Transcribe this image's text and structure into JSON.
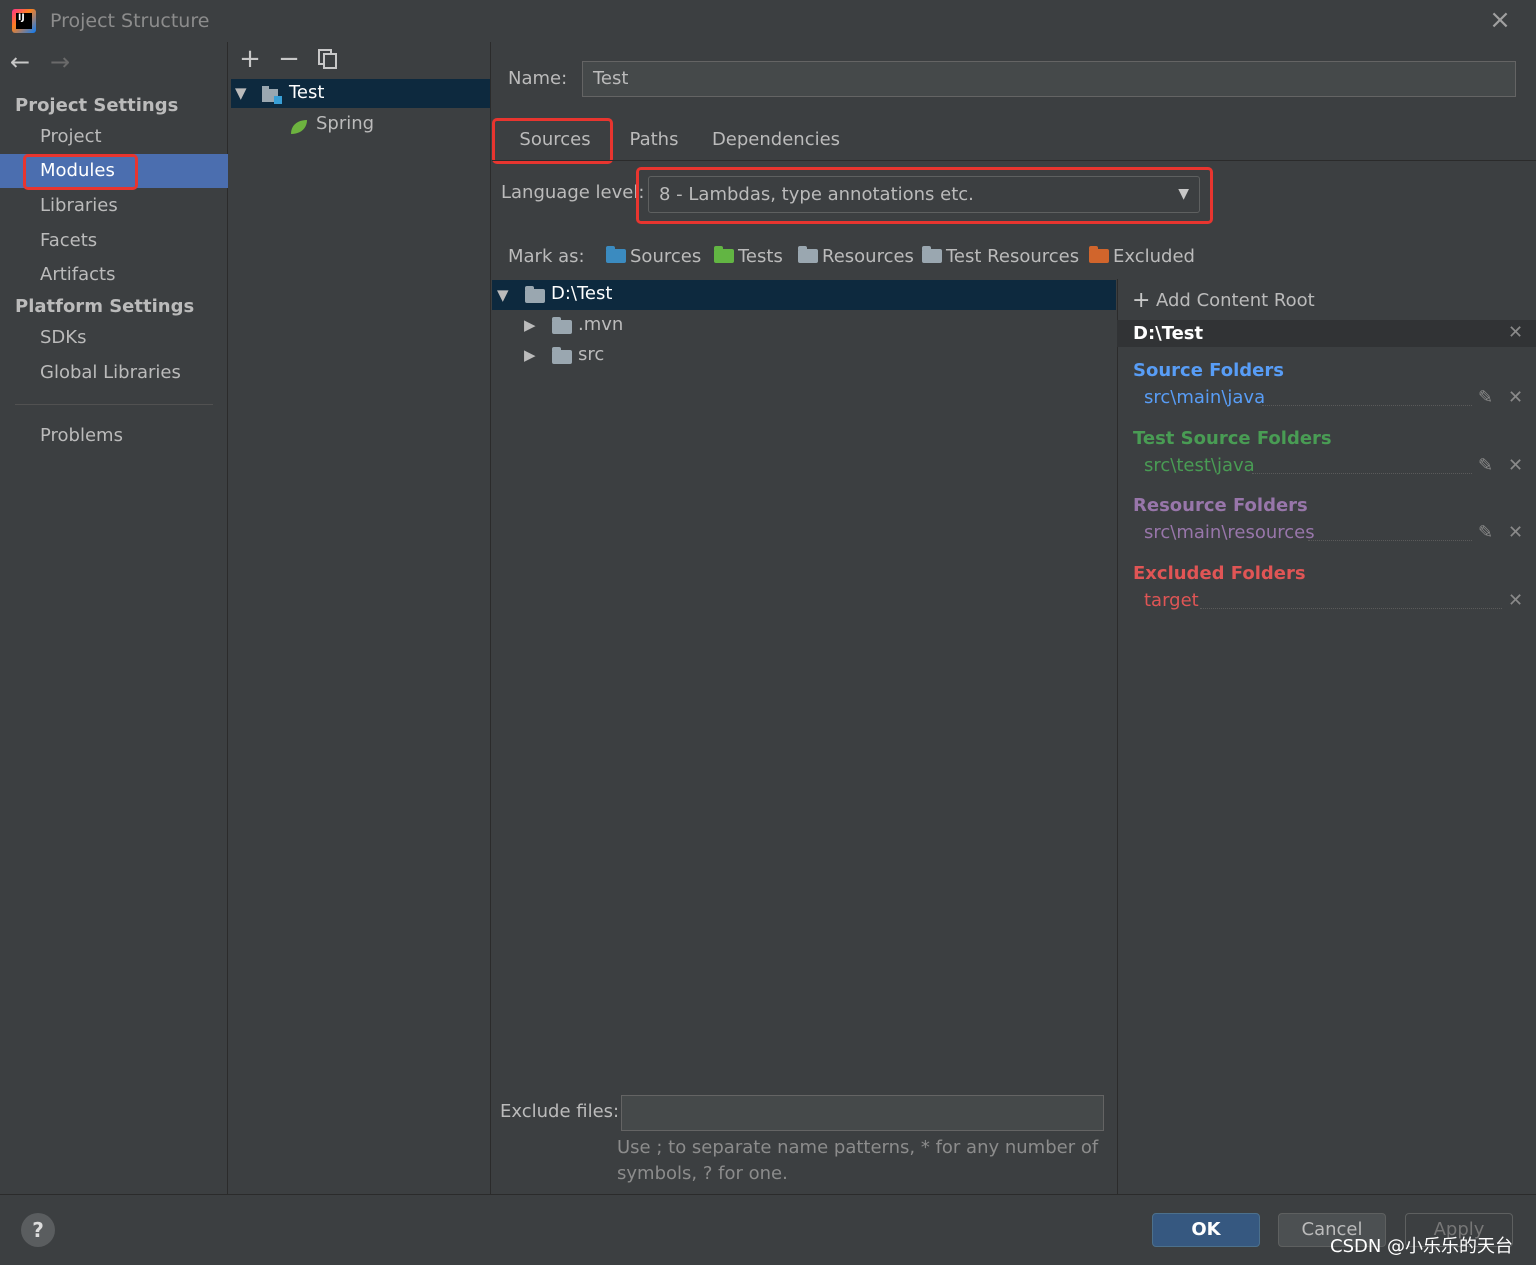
{
  "window": {
    "title": "Project Structure",
    "app_icon_text": "IJ"
  },
  "sidebar": {
    "project_settings_header": "Project Settings",
    "project_items": [
      "Project",
      "Modules",
      "Libraries",
      "Facets",
      "Artifacts"
    ],
    "selected_item": "Modules",
    "platform_settings_header": "Platform Settings",
    "platform_items": [
      "SDKs",
      "Global Libraries"
    ],
    "problems": "Problems"
  },
  "module_tree": {
    "module": "Test",
    "facet": "Spring"
  },
  "main": {
    "name_label": "Name:",
    "name_value": "Test",
    "tabs": [
      "Sources",
      "Paths",
      "Dependencies"
    ],
    "active_tab": "Sources",
    "language_level_label": "Language level:",
    "language_level_value": "8 - Lambdas, type annotations etc.",
    "mark_as_label": "Mark as:",
    "mark_as_buttons": [
      "Sources",
      "Tests",
      "Resources",
      "Test Resources",
      "Excluded"
    ],
    "file_tree": {
      "root": "D:\\Test",
      "children": [
        ".mvn",
        "src"
      ]
    },
    "exclude_files_label": "Exclude files:",
    "exclude_files_value": "",
    "exclude_hint_line1": "Use ; to separate name patterns, * for any number of",
    "exclude_hint_line2": "symbols, ? for one."
  },
  "content_root": {
    "add_label": "Add Content Root",
    "root_path": "D:\\Test",
    "source_folders_title": "Source Folders",
    "source_folder": "src\\main\\java",
    "test_source_folders_title": "Test Source Folders",
    "test_source_folder": "src\\test\\java",
    "resource_folders_title": "Resource Folders",
    "resource_folder": "src\\main\\resources",
    "excluded_folders_title": "Excluded Folders",
    "excluded_folder": "target"
  },
  "buttons": {
    "ok": "OK",
    "cancel": "Cancel",
    "apply": "Apply",
    "help": "?"
  },
  "watermark": "CSDN @小乐乐的天台",
  "colors": {
    "background": "#3c3f41",
    "selection": "#4b6eaf",
    "tree_selection": "#0d293e",
    "source_blue": "#589df6",
    "test_green": "#499c54",
    "resource_purple": "#9876aa",
    "excluded_red": "#e05555",
    "highlight_red": "#e8352f"
  },
  "icons": [
    "back-arrow-icon",
    "forward-arrow-icon",
    "add-icon",
    "remove-icon",
    "copy-icon",
    "module-folder-icon",
    "spring-leaf-icon",
    "dropdown-chevron-icon",
    "folder-icon",
    "edit-pencil-icon",
    "close-icon",
    "help-icon"
  ]
}
